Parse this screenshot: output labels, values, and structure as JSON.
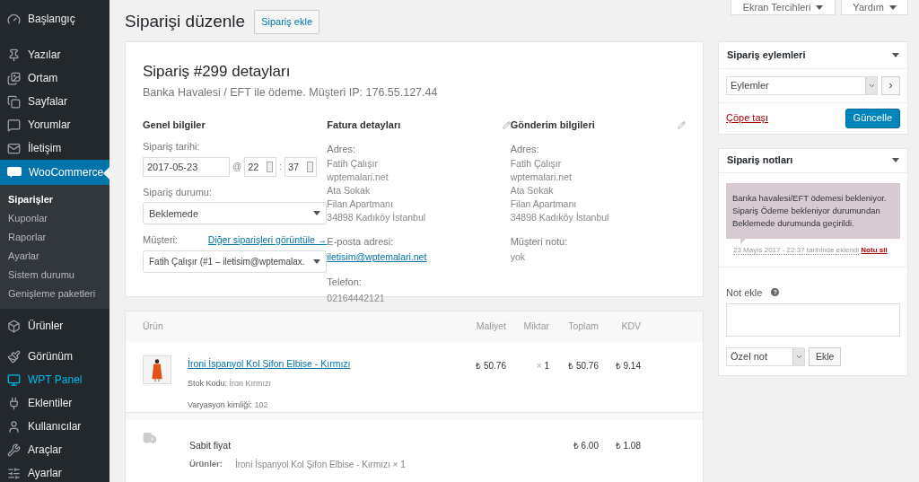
{
  "sidebar": {
    "items": [
      {
        "label": "Başlangıç",
        "selected": false,
        "hover": false
      },
      {
        "label": "Yazılar",
        "selected": false,
        "hover": false
      },
      {
        "label": "Ortam",
        "selected": false,
        "hover": false
      },
      {
        "label": "Sayfalar",
        "selected": false,
        "hover": false
      },
      {
        "label": "Yorumlar",
        "selected": false,
        "hover": false
      },
      {
        "label": "İletişim",
        "selected": false,
        "hover": false
      },
      {
        "label": "WooCommerce",
        "selected": true,
        "hover": false,
        "children": [
          {
            "label": "Siparişler",
            "selected": true
          },
          {
            "label": "Kuponlar",
            "selected": false
          },
          {
            "label": "Raporlar",
            "selected": false
          },
          {
            "label": "Ayarlar",
            "selected": false
          },
          {
            "label": "Sistem durumu",
            "selected": false
          },
          {
            "label": "Genişleme paketleri",
            "selected": false
          }
        ]
      },
      {
        "label": "Ürünler",
        "selected": false,
        "hover": false
      },
      {
        "label": "Görünüm",
        "selected": false,
        "hover": false
      },
      {
        "label": "WPT Panel",
        "selected": false,
        "hover": true
      },
      {
        "label": "Eklentiler",
        "selected": false,
        "hover": false
      },
      {
        "label": "Kullanıcılar",
        "selected": false,
        "hover": false
      },
      {
        "label": "Araçlar",
        "selected": false,
        "hover": false
      },
      {
        "label": "Ayarlar",
        "selected": false,
        "hover": false
      }
    ]
  },
  "header": {
    "title": "Siparişi düzenle",
    "add_button": "Sipariş ekle",
    "screen_options": "Ekran Tercihleri",
    "help": "Yardım"
  },
  "order": {
    "title": "Sipariş #299 detayları",
    "subtitle": "Banka Havalesi / EFT ile ödeme. Müşteri IP: 176.55.127.44",
    "general": {
      "heading": "Genel bilgiler",
      "date_label": "Sipariş tarihi:",
      "date": "2017-05-23",
      "at": "@",
      "hour": "22",
      "colon": ":",
      "minute": "37",
      "status_label": "Sipariş durumu:",
      "status": "Beklemede",
      "customer_label": "Müşteri:",
      "other_orders_link": "Diğer siparişleri görüntüle →",
      "customer": "Fatih Çalışır (#1 – iletisim@wptemalax."
    },
    "billing": {
      "heading": "Fatura detayları",
      "address_label": "Adres:",
      "address": [
        "Fatih Çalışır",
        "wptemalari.net",
        "Ata Sokak",
        "Filan Apartmanı",
        "34898 Kadıköy İstanbul"
      ],
      "email_label": "E-posta adresi:",
      "email": "iletisim@wptemalari.net",
      "phone_label": "Telefon:",
      "phone": "02164442121"
    },
    "shipping": {
      "heading": "Gönderim bilgileri",
      "address_label": "Adres:",
      "address": [
        "Fatih Çalışır",
        "wptemalari.net",
        "Ata Sokak",
        "Filan Apartmanı",
        "34898 Kadıköy İstanbul"
      ],
      "note_label": "Müşteri notu:",
      "note": "yok"
    }
  },
  "items": {
    "columns": [
      "Ürün",
      "Maliyet",
      "Miktar",
      "Toplam",
      "KDV"
    ],
    "product": {
      "name": "İroni İspanyol Kol Şifon Elbise - Kırmızı",
      "sku_label": "Stok Kodu:",
      "sku": "İron Kırmızı",
      "variation_label": "Varyasyon kimliği:",
      "variation": "102",
      "cost": "₺ 50.76",
      "qty_x": "×",
      "qty": "1",
      "total": "₺ 50.76",
      "tax": "₺ 9.14"
    },
    "shipping": {
      "name": "Sabit fiyat",
      "products_label": "Ürünler:",
      "products": "İroni İspanyol Kol Şifon Elbise - Kırmızı × 1",
      "total": "₺ 6.00",
      "tax": "₺ 1.08"
    }
  },
  "actions": {
    "title": "Sipariş eylemleri",
    "select": "Eylemler",
    "go": "›",
    "trash": "Çöpe taşı",
    "update": "Güncelle"
  },
  "notes": {
    "title": "Sipariş notları",
    "note": "Banka havalesi/EFT ödemesi bekleniyor. Sipariş Ödeme bekleniyor durumundan Beklemede durumunda geçirildi.",
    "meta": "23 Mayıs 2017 - 22:37 tarihinde eklendi",
    "delete": "Notu sil",
    "add_label": "Not ekle",
    "help": "?",
    "type": "Özel not",
    "add_button": "Ekle"
  }
}
